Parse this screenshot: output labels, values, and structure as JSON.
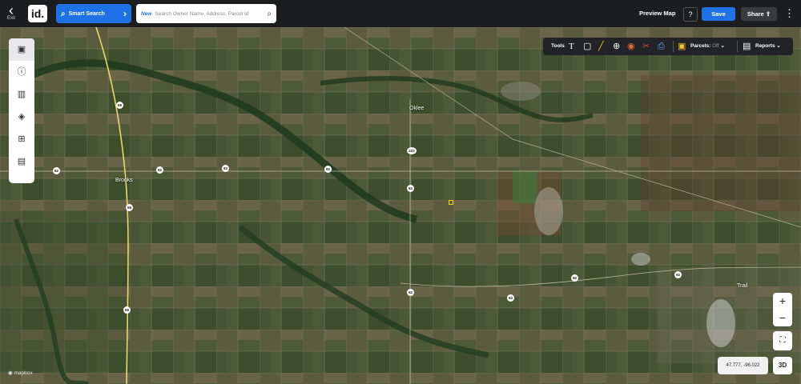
{
  "topbar": {
    "exit_label": "Exit",
    "logo": "id.",
    "smart_search_label": "Smart Search",
    "search_new_tag": "New",
    "search_placeholder": "Search Owner Name, Address, Parcel Id",
    "preview_map_label": "Preview Map",
    "help_label": "?",
    "save_label": "Save",
    "share_label": "Share"
  },
  "toolsbar": {
    "tools_label": "Tools",
    "parcels_label": "Parcels:",
    "parcels_state": "Off",
    "reports_label": "Reports",
    "tool_icons": [
      "text-icon",
      "text-box-icon",
      "ruler-icon",
      "globe-icon",
      "circle-icon",
      "scissors-icon",
      "print-icon"
    ]
  },
  "left_toolbar": {
    "items": [
      "layers-panel-icon",
      "info-icon",
      "map-book-icon",
      "stack-icon",
      "hierarchy-icon",
      "image-export-icon"
    ]
  },
  "map": {
    "places": [
      {
        "name": "Oklee"
      },
      {
        "name": "Brooks"
      },
      {
        "name": "Trail"
      }
    ],
    "shields": [
      "59",
      "59",
      "59",
      "92",
      "92",
      "92",
      "92",
      "92",
      "92",
      "92",
      "92",
      "92",
      "222"
    ],
    "coordinates": "47.777, -96.022",
    "attribution": "mapbox",
    "mode_3d_label": "3D",
    "zoom_in": "+",
    "zoom_out": "−"
  }
}
